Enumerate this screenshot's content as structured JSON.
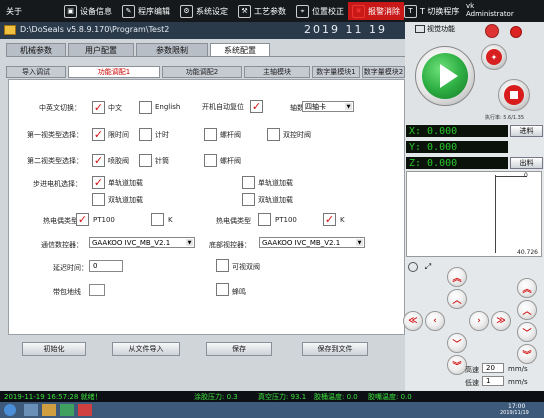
{
  "menubar": {
    "about": "关于",
    "items": [
      {
        "label": "设备信息",
        "icon": "monitor-icon"
      },
      {
        "label": "程序编辑",
        "icon": "edit-icon"
      },
      {
        "label": "系统设定",
        "icon": "settings-icon"
      },
      {
        "label": "工艺参数",
        "icon": "process-icon"
      },
      {
        "label": "位置校正",
        "icon": "target-icon"
      },
      {
        "label": "报警消除",
        "icon": "alarm-icon"
      },
      {
        "label": "T 切换程序",
        "icon": "t-switch-icon"
      }
    ],
    "user": {
      "name": "vk",
      "role": "Administrator"
    }
  },
  "titlebar": {
    "path": "D:\\DoSeals v5.8.9.170\\Program\\Test2",
    "date": "2019 11 19"
  },
  "tabs": [
    "机械参数",
    "用户配置",
    "参数限制",
    "系统配置"
  ],
  "subtabs": [
    "导入调试",
    "功能调配1",
    "功能调配2",
    "主轴模块",
    "数字量模块1",
    "数字量模块2"
  ],
  "form": {
    "lang_label": "中英文切换：",
    "lang_zh": "中文",
    "lang_en": "English",
    "boot_label": "开机自动复位",
    "axis_card_label": "轴数",
    "axis_card_value": "四轴卡",
    "line1_label": "第一视类型选择：",
    "line1_opt1": "限时间",
    "line1_opt2": "计时",
    "line1_opt3": "螺杆阀",
    "line1_opt4": "双控时阀",
    "line2_label": "第二视类型选择：",
    "line2_opt1": "喷胶阀",
    "line2_opt2": "针筒",
    "line2_opt3": "螺杆阀",
    "stepper_label": "步进电机选择：",
    "stepper_opt1": "单轨道加载",
    "stepper_opt2": "单轨道加载",
    "stepper_opt3": "双轨道加载",
    "stepper_opt4": "双轨道加载",
    "thermo1_label": "热电偶类型",
    "thermo1_pt": "PT100",
    "thermo1_k": "K",
    "thermo2_label": "热电偶类型",
    "thermo2_pt": "PT100",
    "thermo2_k": "K",
    "vision1_label": "通信数控器：",
    "vision1_value": "GAAKOO IVC_MB_V2.1",
    "vision2_label": "底部视控器：",
    "vision2_value": "GAAKOO IVC_MB_V2.1",
    "delay_label": "延迟时间：",
    "delay_value": "0",
    "dual_ctrl": "可视双阀",
    "power_label": "带包地线",
    "buzzer": "蜂鸣"
  },
  "buttons": [
    "初始化",
    "从文件导入",
    "保存",
    "保存到文件"
  ],
  "right": {
    "estop_label": "视觉功能",
    "speed_note": "执行率: 5.6/1.35",
    "x": "X: 0.000",
    "y": "Y: 0.000",
    "z": "Z: 0.000",
    "into": "进料",
    "out": "出料",
    "chart_top": "0",
    "chart_bottom": "40.726",
    "high_label": "高速",
    "high_value": "20",
    "high_unit": "mm/s",
    "low_label": "低速",
    "low_value": "1",
    "low_unit": "mm/s"
  },
  "statusbar": {
    "left": "2019-11-19 16:57:28 就绪！",
    "mid1": "涂胶压力: 0.3",
    "mid2": "真空压力: 93.1",
    "mid3": "胶桶温度: 0.0",
    "mid4": "胶嘴温度: 0.0"
  },
  "taskbar": {
    "clock": "17:00",
    "date": "2019/11/19"
  }
}
